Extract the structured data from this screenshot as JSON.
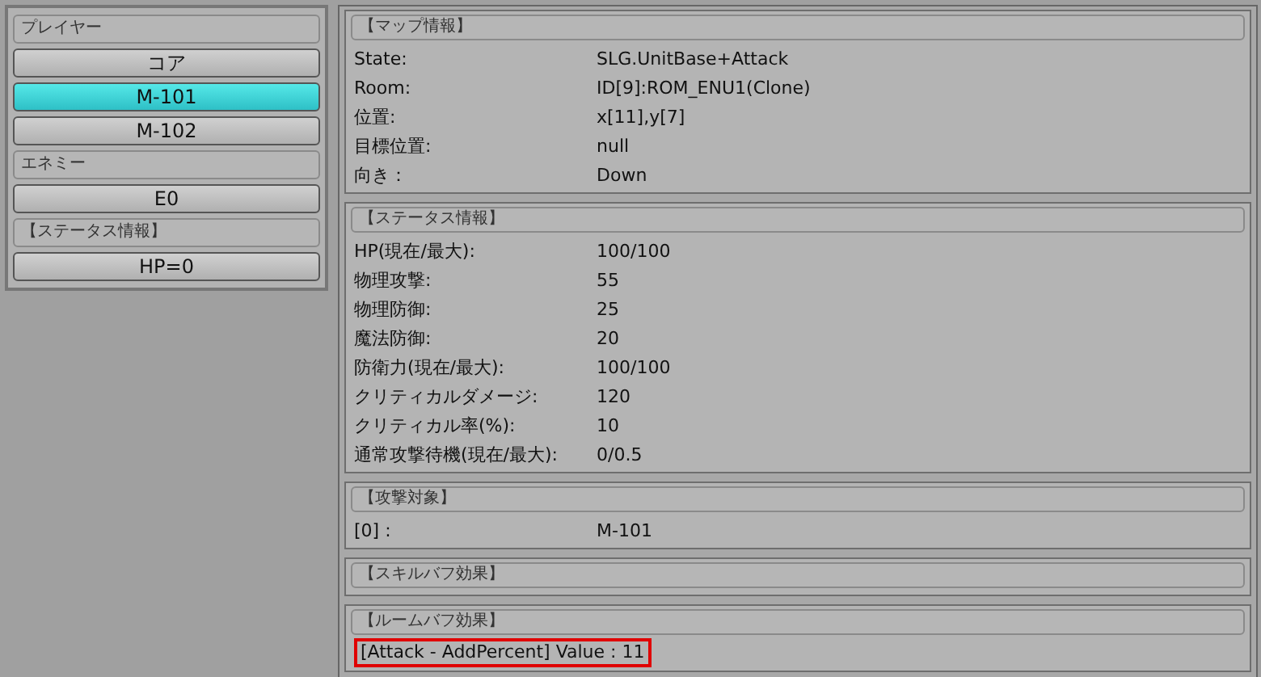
{
  "sidebar": {
    "items": [
      {
        "kind": "header",
        "label": "プレイヤー"
      },
      {
        "kind": "button",
        "label": "コア",
        "selected": false
      },
      {
        "kind": "button",
        "label": "M-101",
        "selected": true
      },
      {
        "kind": "button",
        "label": "M-102",
        "selected": false
      },
      {
        "kind": "header",
        "label": "エネミー"
      },
      {
        "kind": "button",
        "label": "E0",
        "selected": false
      },
      {
        "kind": "header",
        "label": "【ステータス情報】"
      },
      {
        "kind": "button",
        "label": "HP=0",
        "selected": false
      }
    ]
  },
  "sections": [
    {
      "title": "【マップ情報】",
      "rows": [
        {
          "label": "State:",
          "value": "SLG.UnitBase+Attack"
        },
        {
          "label": "Room:",
          "value": "ID[9]:ROM_ENU1(Clone)"
        },
        {
          "label": "位置:",
          "value": "x[11],y[7]"
        },
        {
          "label": "目標位置:",
          "value": "null"
        },
        {
          "label": "向き：",
          "value": "Down"
        }
      ]
    },
    {
      "title": "【ステータス情報】",
      "rows": [
        {
          "label": "HP(現在/最大):",
          "value": "100/100"
        },
        {
          "label": "物理攻撃:",
          "value": "55"
        },
        {
          "label": "物理防御:",
          "value": "25"
        },
        {
          "label": "魔法防御:",
          "value": "20"
        },
        {
          "label": "防衛力(現在/最大):",
          "value": "100/100"
        },
        {
          "label": "クリティカルダメージ:",
          "value": "120"
        },
        {
          "label": "クリティカル率(%):",
          "value": "10"
        },
        {
          "label": "通常攻撃待機(現在/最大):",
          "value": "0/0.5"
        }
      ]
    },
    {
      "title": "【攻撃対象】",
      "rows": [
        {
          "label": "[0] :",
          "value": "M-101"
        }
      ]
    },
    {
      "title": "【スキルバフ効果】"
    },
    {
      "title": "【ルームバフ効果】",
      "lines": [
        {
          "text": "[Attack - AddPercent] Value : 11",
          "highlighted": true
        }
      ]
    }
  ]
}
